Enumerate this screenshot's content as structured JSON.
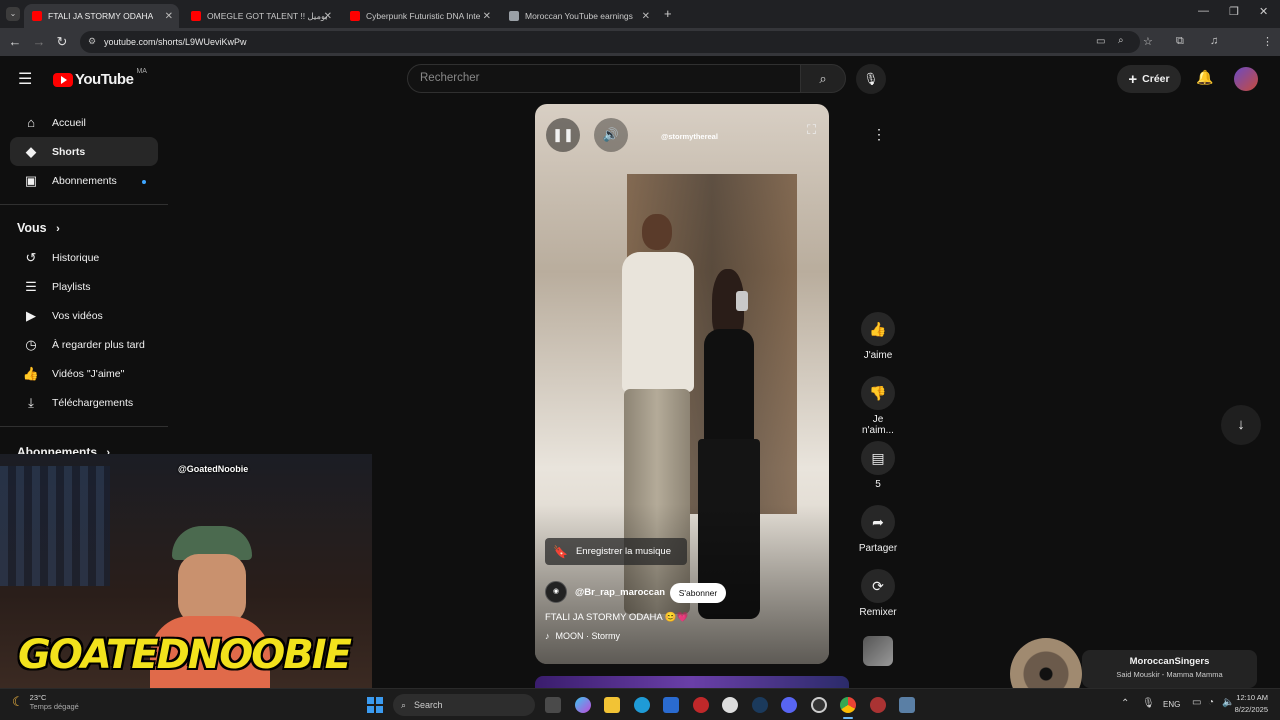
{
  "browser": {
    "tabs": [
      {
        "title": "FTALI JA STORMY ODAHA",
        "active": true,
        "color": "#ff0000"
      },
      {
        "title": "OMEGLE GOT TALENT !! يوميل",
        "active": false,
        "color": "#ff0000"
      },
      {
        "title": "Cyberpunk Futuristic DNA Inte",
        "active": false,
        "color": "#ff0000"
      },
      {
        "title": "Moroccan YouTube earnings",
        "active": false,
        "color": "#9aa0a6"
      }
    ],
    "url": "youtube.com/shorts/L9WUeviKwPw"
  },
  "youtube": {
    "logo_text": "YouTube",
    "region": "MA",
    "search_placeholder": "Rechercher",
    "create_label": "Créer",
    "sidebar": {
      "main": [
        {
          "label": "Accueil",
          "icon": "home-icon",
          "glyph": "⌂"
        },
        {
          "label": "Shorts",
          "icon": "shorts-icon",
          "glyph": "◆"
        },
        {
          "label": "Abonnements",
          "icon": "subscriptions-icon",
          "glyph": "▣"
        }
      ],
      "you_heading": "Vous",
      "you_items": [
        {
          "label": "Historique",
          "icon": "history-icon",
          "glyph": "↺"
        },
        {
          "label": "Playlists",
          "icon": "playlists-icon",
          "glyph": "☰"
        },
        {
          "label": "Vos vidéos",
          "icon": "your-videos-icon",
          "glyph": "▶"
        },
        {
          "label": "À regarder plus tard",
          "icon": "watch-later-icon",
          "glyph": "◷"
        },
        {
          "label": "Vidéos \"J'aime\"",
          "icon": "liked-videos-icon",
          "glyph": "👍"
        },
        {
          "label": "Téléchargements",
          "icon": "downloads-icon",
          "glyph": "⤓"
        }
      ],
      "subs_heading": "Abonnements"
    },
    "short": {
      "watermark": "@stormythereal",
      "save_music": "Enregistrer la musique",
      "channel": "@Br_rap_maroccan",
      "subscribe": "S'abonner",
      "title": "FTALI JA STORMY ODAHA 😊💗",
      "music": "MOON · Stormy"
    },
    "actions": [
      {
        "label": "J'aime",
        "icon": "like-icon",
        "glyph": "👍"
      },
      {
        "label": "Je n'aim...",
        "icon": "dislike-icon",
        "glyph": "👎"
      },
      {
        "label": "5",
        "icon": "comments-icon",
        "glyph": "▤"
      },
      {
        "label": "Partager",
        "icon": "share-icon",
        "glyph": "➦"
      },
      {
        "label": "Remixer",
        "icon": "remix-icon",
        "glyph": "⟳"
      }
    ]
  },
  "overlay": {
    "streamer_handle": "@GoatedNoobie",
    "streamer_banner": "GOATEDNOOBIE",
    "now_playing_artist": "MoroccanSingers",
    "now_playing_track": "Said Mouskir - Mamma Mamma"
  },
  "taskbar": {
    "weather_temp": "23°C",
    "weather_desc": "Temps dégagé",
    "search_label": "Search",
    "lang": "ENG",
    "time": "12:10 AM",
    "date": "8/22/2025"
  }
}
